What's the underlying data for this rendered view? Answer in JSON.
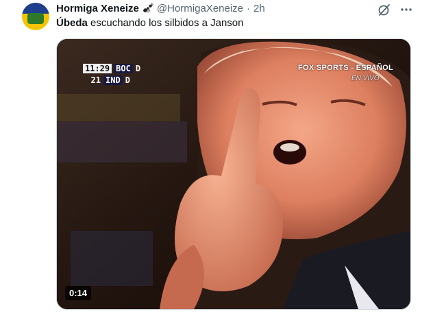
{
  "tweet": {
    "author_name": "Hormiga Xeneize",
    "author_emoji_icon": "ant-icon",
    "handle": "@HormigaXeneize",
    "separator": "·",
    "time": "2h",
    "text_bold": "Úbeda",
    "text_rest": "escuchando los silbidos a Janson"
  },
  "video": {
    "scoreboard": {
      "clock": "11:29",
      "home_team": "BOC",
      "home_flag": "D",
      "score": "21",
      "away_team": "IND",
      "away_flag": "D"
    },
    "broadcaster": "FOX SPORTS - ESPAÑOL",
    "live_label": "EN VIVO",
    "duration": "0:14"
  },
  "icons": {
    "grok": "grok-icon",
    "more": "more-icon"
  },
  "colors": {
    "secondary_text": "#536471",
    "border": "#cfd9de"
  }
}
